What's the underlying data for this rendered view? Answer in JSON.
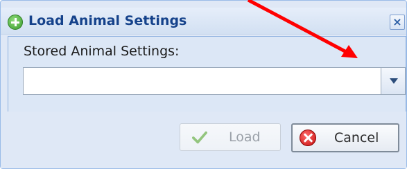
{
  "dialog": {
    "title": "Load Animal Settings",
    "close_icon": "close-icon",
    "header_icon": "add-icon"
  },
  "form": {
    "label": "Stored Animal Settings:",
    "combo_value": "",
    "dropdown_icon": "chevron-down-icon"
  },
  "buttons": {
    "load_label": "Load",
    "load_icon": "check-icon",
    "cancel_label": "Cancel",
    "cancel_icon": "cancel-icon"
  },
  "colors": {
    "accent": "#15428b",
    "panel": "#dce7f6",
    "annotation_arrow": "#ff0000"
  }
}
